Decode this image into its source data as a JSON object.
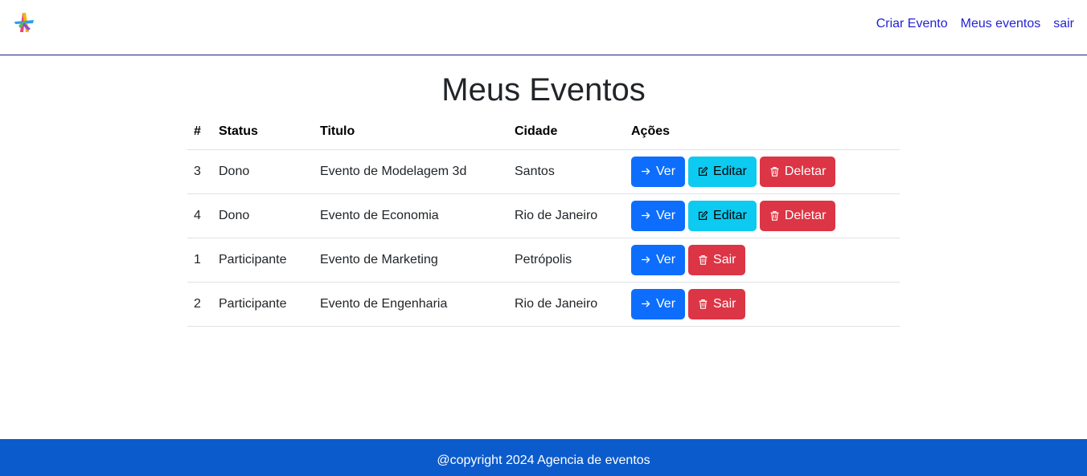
{
  "nav": {
    "logo_icon": "colorful-star-logo-icon",
    "links": [
      "Criar Evento",
      "Meus eventos",
      "sair"
    ],
    "link_color": "#2323d6"
  },
  "page": {
    "title": "Meus Eventos"
  },
  "table": {
    "headers": [
      "#",
      "Status",
      "Titulo",
      "Cidade",
      "Ações"
    ],
    "rows": [
      {
        "id": "3",
        "status": "Dono",
        "title": "Evento de Modelagem 3d",
        "city": "Santos",
        "actions": [
          {
            "label": "Ver",
            "icon": "arrow-right-icon",
            "style": "primary"
          },
          {
            "label": "Editar",
            "icon": "edit-icon",
            "style": "info"
          },
          {
            "label": "Deletar",
            "icon": "trash-icon",
            "style": "danger"
          }
        ]
      },
      {
        "id": "4",
        "status": "Dono",
        "title": "Evento de Economia",
        "city": "Rio de Janeiro",
        "actions": [
          {
            "label": "Ver",
            "icon": "arrow-right-icon",
            "style": "primary"
          },
          {
            "label": "Editar",
            "icon": "edit-icon",
            "style": "info"
          },
          {
            "label": "Deletar",
            "icon": "trash-icon",
            "style": "danger"
          }
        ]
      },
      {
        "id": "1",
        "status": "Participante",
        "title": "Evento de Marketing",
        "city": "Petrópolis",
        "actions": [
          {
            "label": "Ver",
            "icon": "arrow-right-icon",
            "style": "primary"
          },
          {
            "label": "Sair",
            "icon": "trash-icon",
            "style": "danger"
          }
        ]
      },
      {
        "id": "2",
        "status": "Participante",
        "title": "Evento de Engenharia",
        "city": "Rio de Janeiro",
        "actions": [
          {
            "label": "Ver",
            "icon": "arrow-right-icon",
            "style": "primary"
          },
          {
            "label": "Sair",
            "icon": "trash-icon",
            "style": "danger"
          }
        ]
      }
    ]
  },
  "footer": {
    "text": "@copyright 2024 Agencia de eventos",
    "background": "#0b5bcc"
  },
  "colors": {
    "primary": "#0d6efd",
    "info": "#0dcaf0",
    "danger": "#dc3545"
  }
}
